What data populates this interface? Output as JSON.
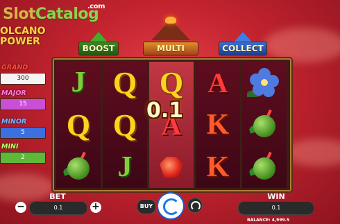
{
  "watermark": {
    "brand_slot": "Slot",
    "brand_catalog": "Catalog",
    "dotcom": ".com"
  },
  "game": {
    "title_line1": "OLCANO",
    "title_line2": "POWER"
  },
  "jackpots": [
    {
      "label": "GRAND",
      "value": "300"
    },
    {
      "label": "MAJOR",
      "value": "15"
    },
    {
      "label": "MINOR",
      "value": "5"
    },
    {
      "label": "MINI",
      "value": "2"
    }
  ],
  "features": {
    "boost": "BOOST",
    "multi": "MULTI",
    "collect": "COLLECT"
  },
  "reels": {
    "r0": [
      "J",
      "Q",
      "Q",
      "A",
      "flower"
    ],
    "r1": [
      "Q",
      "Q",
      "A",
      "K",
      "coconut"
    ],
    "r2": [
      "coconut",
      "J",
      "ruby",
      "K",
      "coconut"
    ],
    "win_value": "0.1",
    "icons": {
      "flower": "hibiscus-icon",
      "coconut": "coconut-drink-icon",
      "ruby": "ruby-gem-icon"
    }
  },
  "controls": {
    "bet_label": "BET",
    "bet_value": "0.1",
    "minus": "−",
    "plus": "+",
    "buy_label": "BUY",
    "win_label": "WIN",
    "win_value": "0.1",
    "balance": "BALANCE: 4,999.5"
  },
  "colors": {
    "background": "#c2232e",
    "frame": "#b07a3a",
    "spin_accent": "#1e7ae0"
  }
}
